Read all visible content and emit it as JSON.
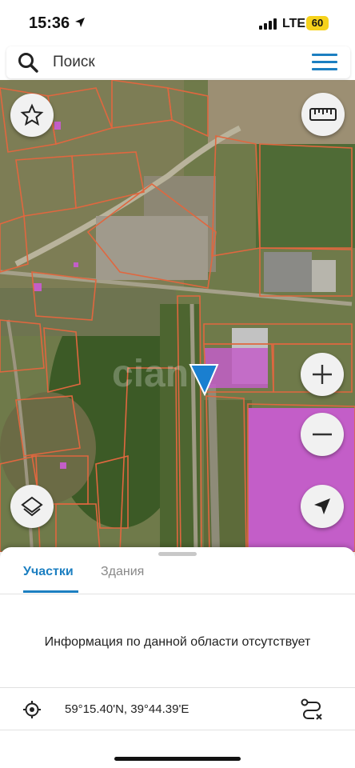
{
  "status_bar": {
    "time": "15:36",
    "network": "LTE",
    "battery": "60",
    "battery_color": "#f6d21b"
  },
  "search": {
    "placeholder": "Поиск",
    "icons": [
      "search-icon",
      "menu-icon"
    ]
  },
  "map": {
    "watermark": "cian",
    "buttons": [
      "favorite-star-icon",
      "ruler-icon",
      "zoom-in-icon",
      "zoom-out-icon",
      "layers-icon",
      "navigation-arrow-icon"
    ],
    "parcel_outline_color": "#e0673f",
    "building_highlight_color": "#c35ec8",
    "location_marker_color": "#1a7fd0"
  },
  "sheet": {
    "tabs": [
      {
        "label": "Участки",
        "active": true
      },
      {
        "label": "Здания",
        "active": false
      }
    ],
    "empty_message": "Информация по данной области отсутствует",
    "coordinates": "59°15.40'N, 39°44.39'E",
    "accent_color": "#1c7fc1"
  }
}
